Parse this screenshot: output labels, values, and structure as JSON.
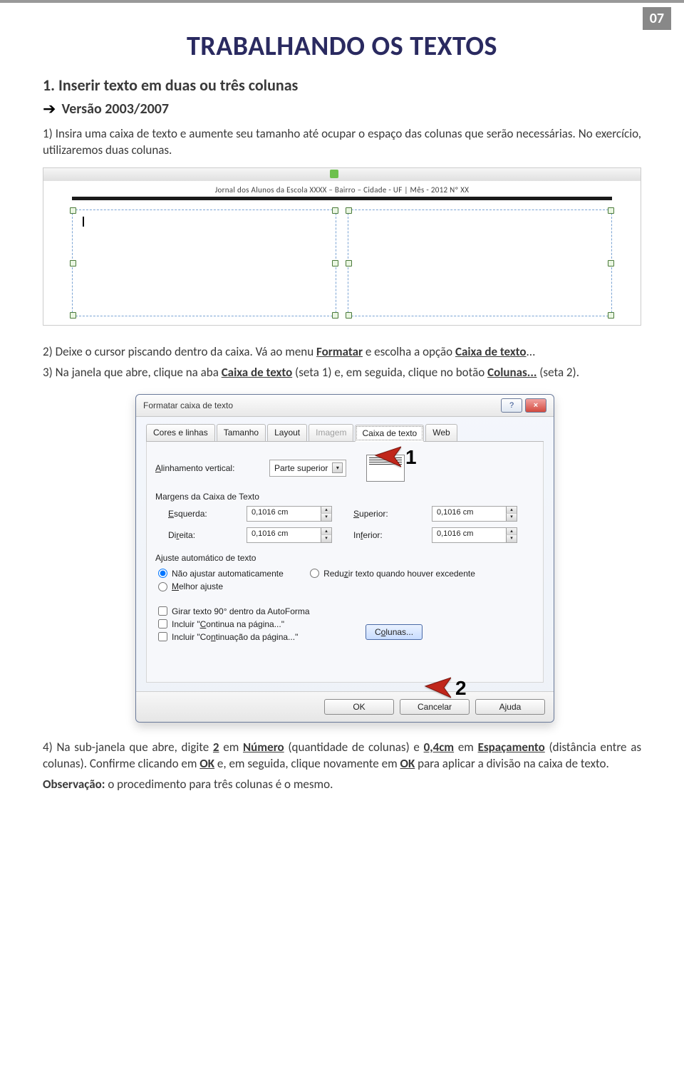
{
  "page_number": "07",
  "title": "TRABALHANDO OS TEXTOS",
  "subtitle": "1. Inserir texto em duas ou três colunas",
  "version_label": "Versão 2003/2007",
  "body": {
    "p1": "1) Insira uma caixa de texto e aumente seu tamanho até ocupar o espaço das colunas que serão necessárias. No exercício, utilizaremos duas colunas.",
    "p2_pre": "2) Deixe o cursor piscando dentro da caixa. Vá ao menu ",
    "p2_u1": "Formatar",
    "p2_mid": " e escolha a opção ",
    "p2_u2": "Caixa de texto",
    "p2_post": "...",
    "p3_pre": "3) Na janela que abre, clique na aba ",
    "p3_u1": "Caixa de texto",
    "p3_mid": " (seta 1) e, em seguida, clique no botão ",
    "p3_u2": "Colunas...",
    "p3_post": " (seta 2).",
    "p4_pre": "4) Na sub-janela que abre, digite ",
    "p4_b1": "2",
    "p4_m1": " em ",
    "p4_u1": "Número",
    "p4_m2": " (quantidade de colunas) e ",
    "p4_b2": "0,4cm",
    "p4_m3": " em ",
    "p4_u2": "Espaçamento",
    "p4_m4": " (distância entre as colunas). Confirme clicando em ",
    "p4_u3": "OK",
    "p4_m5": " e, em seguida, clique novamente em ",
    "p4_u4": "OK",
    "p4_m6": " para aplicar a divisão na caixa de texto.",
    "obs_label": "Observação:",
    "obs_text": " o procedimento para três colunas é o mesmo."
  },
  "shot1": {
    "doc_header": "Jornal dos Alunos da Escola XXXX – Bairro – Cidade - UF | Mês - 2012 Nº XX"
  },
  "dialog": {
    "title": "Formatar caixa de texto",
    "help": "?",
    "close": "×",
    "tabs": [
      "Cores e linhas",
      "Tamanho",
      "Layout",
      "Imagem",
      "Caixa de texto",
      "Web"
    ],
    "disabled_tab_index": 3,
    "active_tab_index": 4,
    "align_label": "Alinhamento vertical:",
    "align_value": "Parte superior",
    "margins_header": "Margens da Caixa de Texto",
    "margins": {
      "left_l": "Esquerda:",
      "left_v": "0,1016 cm",
      "right_l": "Direita:",
      "right_v": "0,1016 cm",
      "top_l": "Superior:",
      "top_v": "0,1016 cm",
      "bottom_l": "Inferior:",
      "bottom_v": "0,1016 cm"
    },
    "autofit_header": "Ajuste automático de texto",
    "radios": [
      "Não ajustar automaticamente",
      "Reduzir texto quando houver excedente",
      "Melhor ajuste"
    ],
    "radio_selected": 0,
    "checks": [
      "Girar texto 90° dentro da AutoForma",
      "Incluir \"Continua na página...\"",
      "Incluir \"Continuação da página...\""
    ],
    "columns_btn": "Colunas...",
    "ok": "OK",
    "cancel": "Cancelar",
    "help_btn": "Ajuda",
    "num1": "1",
    "num2": "2"
  }
}
